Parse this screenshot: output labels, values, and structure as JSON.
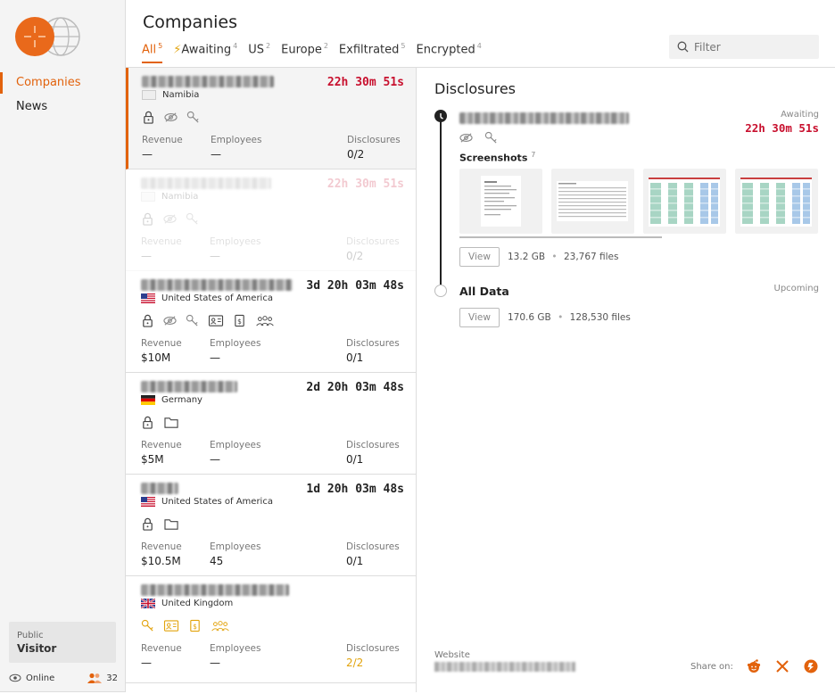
{
  "sidebar": {
    "nav": [
      {
        "label": "Companies",
        "active": true
      },
      {
        "label": "News",
        "active": false
      }
    ],
    "visitor": {
      "small": "Public",
      "big": "Visitor"
    },
    "status": {
      "online": "Online",
      "count": "32"
    }
  },
  "header": {
    "title": "Companies",
    "tabs": [
      {
        "label": "All",
        "count": "5",
        "active": true
      },
      {
        "label": "Awaiting",
        "count": "4",
        "icon": "bolt-icon"
      },
      {
        "label": "US",
        "count": "2"
      },
      {
        "label": "Europe",
        "count": "2"
      },
      {
        "label": "Exfiltrated",
        "count": "5"
      },
      {
        "label": "Encrypted",
        "count": "4"
      }
    ],
    "filter_placeholder": "Filter"
  },
  "companies": [
    {
      "country": "Namibia",
      "timer": "22h 30m 51s",
      "timer_red": true,
      "icons": [
        "lock-icon",
        "eye-icon",
        "key-icon"
      ],
      "revenue_label": "Revenue",
      "revenue": "—",
      "employees_label": "Employees",
      "employees": "—",
      "disclosures_label": "Disclosures",
      "disclosures": "0/2"
    },
    {
      "country": "Namibia",
      "timer": "22h 30m 51s",
      "timer_red": true,
      "icons": [
        "lock-icon",
        "eye-icon",
        "key-icon"
      ],
      "revenue_label": "Revenue",
      "revenue": "—",
      "employees_label": "Employees",
      "employees": "—",
      "disclosures_label": "Disclosures",
      "disclosures": "0/2"
    },
    {
      "country": "United States of America",
      "timer": "3d 20h 03m 48s",
      "icons": [
        "lock-icon",
        "eye-icon",
        "key-icon",
        "id-card-icon",
        "invoice-icon",
        "people-icon"
      ],
      "revenue_label": "Revenue",
      "revenue": "$10M",
      "employees_label": "Employees",
      "employees": "—",
      "disclosures_label": "Disclosures",
      "disclosures": "0/1"
    },
    {
      "country": "Germany",
      "timer": "2d 20h 03m 48s",
      "icons": [
        "lock-icon",
        "folder-icon"
      ],
      "revenue_label": "Revenue",
      "revenue": "$5M",
      "employees_label": "Employees",
      "employees": "—",
      "disclosures_label": "Disclosures",
      "disclosures": "0/1"
    },
    {
      "country": "United States of America",
      "timer": "1d 20h 03m 48s",
      "icons": [
        "lock-icon",
        "folder-icon"
      ],
      "revenue_label": "Revenue",
      "revenue": "$10.5M",
      "employees_label": "Employees",
      "employees": "45",
      "disclosures_label": "Disclosures",
      "disclosures": "0/1"
    },
    {
      "country": "United Kingdom",
      "timer": "",
      "icons": [
        "key-icon",
        "id-card-icon",
        "invoice-icon",
        "people-icon"
      ],
      "revenue_label": "Revenue",
      "revenue": "—",
      "employees_label": "Employees",
      "employees": "—",
      "disclosures_label": "Disclosures",
      "disclosures": "2/2"
    }
  ],
  "disclosures": {
    "title": "Disclosures",
    "first": {
      "status": "Awaiting",
      "timer": "22h 30m 51s",
      "screenshots_label": "Screenshots",
      "screenshots_count": "7",
      "view_label": "View",
      "size": "13.2 GB",
      "files": "23,767 files",
      "separator": "•"
    },
    "second": {
      "name": "All Data",
      "status": "Upcoming",
      "view_label": "View",
      "size": "170.6 GB",
      "files": "128,530 files",
      "separator": "•"
    },
    "website_label": "Website",
    "share_label": "Share on:"
  },
  "colors": {
    "accent": "#e2620c",
    "timer_red": "#c8102e",
    "gold": "#e2a30c"
  }
}
